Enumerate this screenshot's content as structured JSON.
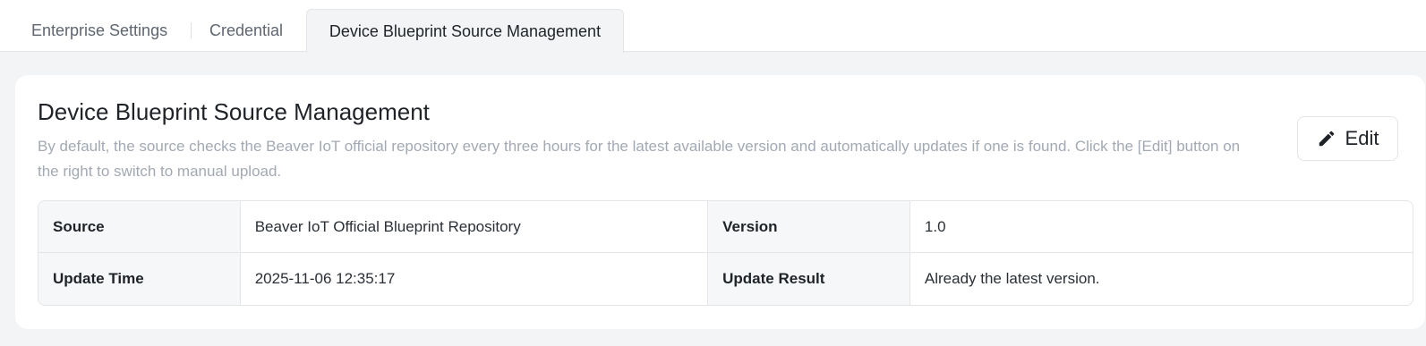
{
  "tabs": {
    "items": [
      {
        "label": "Enterprise Settings"
      },
      {
        "label": "Credential"
      },
      {
        "label": "Device Blueprint Source Management"
      }
    ],
    "active": "Device Blueprint Source Management"
  },
  "card": {
    "title": "Device Blueprint Source Management",
    "description": "By default, the source checks the Beaver IoT official repository every three hours for the latest available version and automatically updates if one is found. Click the [Edit] button on the right to switch to manual upload.",
    "edit_button": {
      "label": "Edit",
      "icon": "pencil-icon"
    }
  },
  "details": {
    "rows": [
      [
        {
          "key": "Source",
          "value": "Beaver IoT Official Blueprint Repository"
        },
        {
          "key": "Version",
          "value": "1.0"
        }
      ],
      [
        {
          "key": "Update Time",
          "value": "2025-11-06 12:35:17"
        },
        {
          "key": "Update Result",
          "value": "Already the latest version."
        }
      ]
    ]
  }
}
